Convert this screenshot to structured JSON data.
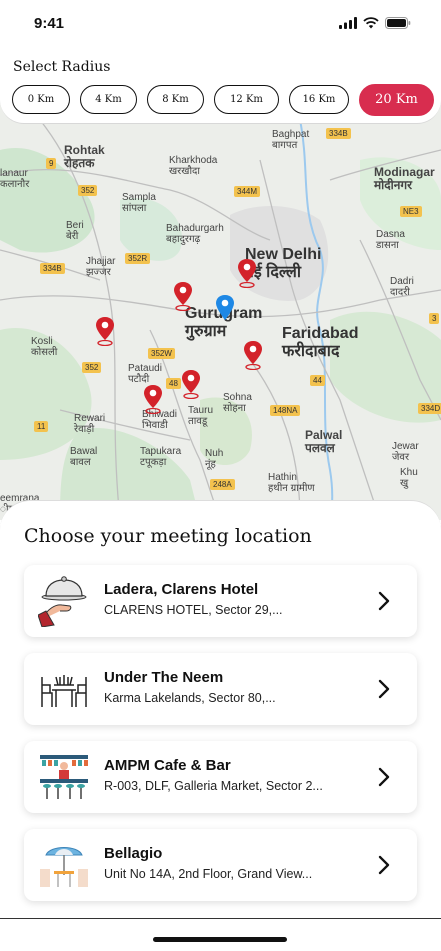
{
  "status_bar": {
    "time": "9:41"
  },
  "radius": {
    "title": "Select Radius",
    "options": [
      "0 Km",
      "4 Km",
      "8 Km",
      "12 Km",
      "16 Km",
      "20 Km"
    ],
    "selected": "20 Km"
  },
  "map": {
    "labels": {
      "baghpat": "Baghpat",
      "baghpat_hi": "बागपत",
      "rohtak": "Rohtak",
      "rohtak_hi": "रोहतक",
      "kharkhoda": "Kharkhoda",
      "kharkhoda_hi": "खरखौदा",
      "modinagar": "Modinagar",
      "modinagar_hi": "मोदीनगर",
      "kalanaur": "lanaur",
      "kalanaur_hi": "कलानौर",
      "sampla": "Sampla",
      "sampla_hi": "सांपला",
      "bahadurgarh": "Bahadurgarh",
      "bahadurgarh_hi": "बहादुरगढ़",
      "beri": "Beri",
      "beri_hi": "बेरी",
      "new_delhi": "New Delhi",
      "new_delhi_hi": "नई दिल्ली",
      "dasna": "Dasna",
      "dasna_hi": "डासना",
      "jhajjar": "Jhajjar",
      "jhajjar_hi": "झज्जर",
      "dadri": "Dadri",
      "dadri_hi": "दादरी",
      "gurugram": "Gurugram",
      "gurugram_hi": "गुरुग्राम",
      "faridabad": "Faridabad",
      "faridabad_hi": "फरीदाबाद",
      "kosli": "Kosli",
      "kosli_hi": "कोसली",
      "pataudi": "Pataudi",
      "pataudi_hi": "पटौदी",
      "sohna": "Sohna",
      "sohna_hi": "सोहना",
      "bhiwadi": "Bhiwadi",
      "bhiwadi_hi": "भिवाडी",
      "tauru": "Tauru",
      "tauru_hi": "तावडू",
      "rewari": "Rewari",
      "rewari_hi": "रेवाड़ी",
      "palwal": "Palwal",
      "palwal_hi": "पलवल",
      "jewar": "Jewar",
      "jewar_hi": "जेवर",
      "bawal": "Bawal",
      "bawal_hi": "बावल",
      "tapukara": "Tapukara",
      "tapukara_hi": "टपूकड़ा",
      "nuh": "Nuh",
      "nuh_hi": "नूंह",
      "hathin": "Hathin",
      "hathin_hi": "हथीन ग्रामीण",
      "khurja": "Khu",
      "khurja_hi": "खु",
      "neemrana": "eemrana",
      "neemrana_hi": "ीमराना"
    },
    "roads": [
      "334B",
      "9",
      "344M",
      "352",
      "NE3",
      "352R",
      "334B",
      "352W",
      "3",
      "352",
      "48",
      "44",
      "148NA",
      "334D",
      "11",
      "248A"
    ]
  },
  "sheet": {
    "title": "Choose your meeting location",
    "locations": [
      {
        "name": "Ladera, Clarens Hotel",
        "address": "CLARENS HOTEL, Sector 29,...",
        "icon": "cloche-serving-icon"
      },
      {
        "name": "Under The Neem",
        "address": "Karma Lakelands, Sector 80,...",
        "icon": "dining-table-icon"
      },
      {
        "name": "AMPM Cafe & Bar",
        "address": "R-003, DLF, Galleria Market, Sector 2...",
        "icon": "bar-counter-icon"
      },
      {
        "name": "Bellagio",
        "address": "Unit No 14A, 2nd Floor, Grand View...",
        "icon": "umbrella-table-icon"
      }
    ]
  },
  "colors": {
    "accent": "#d82d4f",
    "pin": "#d3222a",
    "user_pin": "#1e88e5"
  }
}
